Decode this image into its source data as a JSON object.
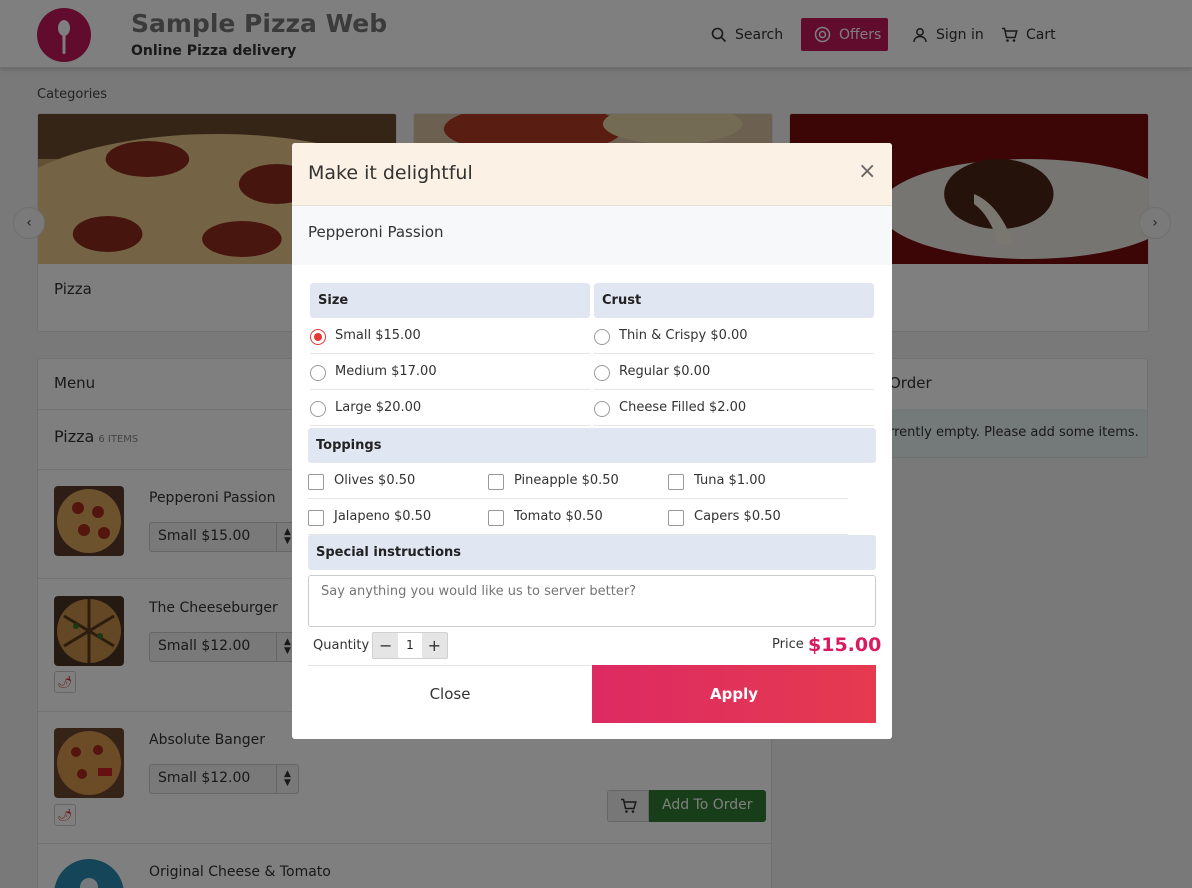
{
  "header": {
    "brand_title": "Sample Pizza Web",
    "brand_subtitle": "Online Pizza delivery",
    "nav": {
      "search": "Search",
      "offers": "Offers",
      "signin": "Sign in",
      "cart": "Cart"
    }
  },
  "categories": {
    "label": "Categories",
    "items": [
      {
        "name": "Pizza"
      },
      {
        "name": ""
      },
      {
        "name": ""
      }
    ]
  },
  "menu": {
    "title": "Menu",
    "section": "Pizza",
    "section_count": "6 ITEMS",
    "items": [
      {
        "name": "Pepperoni Passion",
        "size": "Small $15.00"
      },
      {
        "name": "The Cheeseburger",
        "size": "Small $12.00"
      },
      {
        "name": "Absolute Banger",
        "size": "Small $12.00"
      },
      {
        "name": "Original Cheese & Tomato"
      }
    ],
    "add_to_order": "Add To Order"
  },
  "order": {
    "title": "Order",
    "empty_text": "rrently empty. Please add some items."
  },
  "modal": {
    "title": "Make it delightful",
    "close_icon": "×",
    "product": "Pepperoni Passion",
    "size": {
      "label": "Size",
      "options": [
        "Small $15.00",
        "Medium $17.00",
        "Large $20.00"
      ],
      "selected": "Small $15.00"
    },
    "crust": {
      "label": "Crust",
      "options": [
        "Thin & Crispy $0.00",
        "Regular $0.00",
        "Cheese Filled $2.00"
      ]
    },
    "toppings": {
      "label": "Toppings",
      "options": [
        "Olives $0.50",
        "Pineapple $0.50",
        "Tuna $1.00",
        "Jalapeno $0.50",
        "Tomato $0.50",
        "Capers $0.50"
      ]
    },
    "instructions": {
      "label": "Special instructions",
      "placeholder": "Say anything you would like us to server better?"
    },
    "quantity": {
      "label": "Quantity",
      "value": "1",
      "minus": "−",
      "plus": "+"
    },
    "price": {
      "label": "Price",
      "value": "$15.00"
    },
    "buttons": {
      "close": "Close",
      "apply": "Apply"
    }
  },
  "colors": {
    "brand": "#c2185b",
    "accent": "#e53935",
    "apply": "#dd2a63",
    "add": "#2e7d32"
  }
}
